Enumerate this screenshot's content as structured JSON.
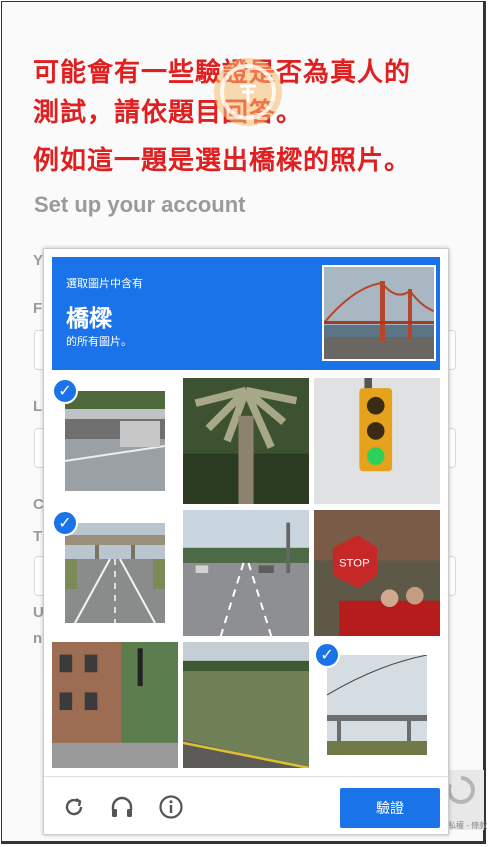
{
  "annotation": {
    "line1": "可能會有一些驗證是否為真人的",
    "line2": "測試，請依題目回答。",
    "line3": "例如這一題是選出橋樑的照片。"
  },
  "background_page": {
    "title": "Set up your account",
    "fragments": [
      "Y",
      "F",
      "L",
      "C",
      "T",
      "U",
      "n"
    ]
  },
  "recaptcha_badge": {
    "text": "隱私權 - 條款"
  },
  "captcha": {
    "header": {
      "line1": "選取圖片中含有",
      "target": "橋樑",
      "line3": "的所有圖片。"
    },
    "tiles": [
      {
        "name": "highway-overpass",
        "selected": true
      },
      {
        "name": "palm-tree",
        "selected": false
      },
      {
        "name": "traffic-light",
        "selected": false
      },
      {
        "name": "road-overpass",
        "selected": true
      },
      {
        "name": "city-street",
        "selected": false
      },
      {
        "name": "stop-sign",
        "selected": false
      },
      {
        "name": "brick-building",
        "selected": false
      },
      {
        "name": "grass-roadside",
        "selected": false
      },
      {
        "name": "bridge-power-lines",
        "selected": true
      }
    ],
    "footer": {
      "reload_icon": "reload-icon",
      "audio_icon": "headphones-icon",
      "info_icon": "info-icon",
      "verify_label": "驗證"
    },
    "colors": {
      "accent": "#1a73e8",
      "annotation": "#e02020"
    }
  }
}
